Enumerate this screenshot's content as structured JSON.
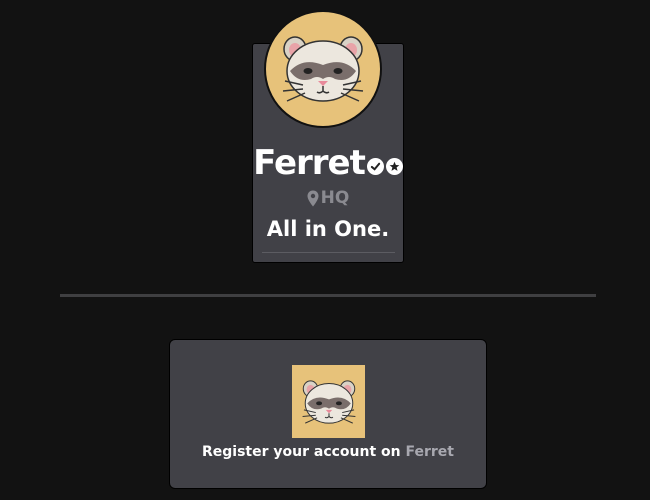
{
  "profile": {
    "name": "Ferret",
    "location": "HQ",
    "tagline": "All in One.",
    "badges": [
      "verified-check-icon",
      "star-badge-icon"
    ]
  },
  "register": {
    "text": "Register your account on",
    "brand": "Ferret"
  },
  "colors": {
    "background": "#121212",
    "card": "#414147",
    "avatar_bg": "#e7c27a",
    "muted_text": "#8a8a90"
  }
}
